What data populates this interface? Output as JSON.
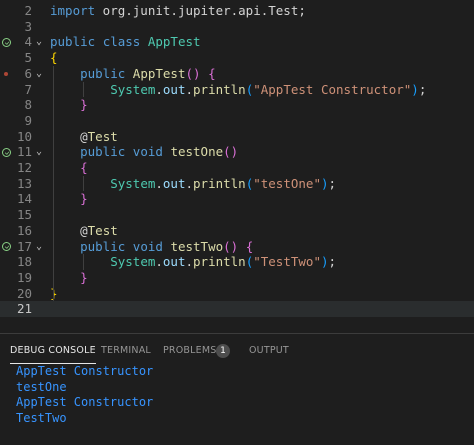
{
  "editor": {
    "lines": [
      {
        "no": "2",
        "icon": "",
        "fold": "",
        "current": false,
        "tokens": [
          [
            "kw",
            "import"
          ],
          [
            "pl",
            " org.junit.jupiter.api.Test;"
          ]
        ]
      },
      {
        "no": "3",
        "icon": "",
        "fold": "",
        "current": false,
        "tokens": []
      },
      {
        "no": "4",
        "icon": "run",
        "fold": "⌄",
        "current": false,
        "tokens": [
          [
            "kw",
            "public"
          ],
          [
            "pl",
            " "
          ],
          [
            "kw",
            "class"
          ],
          [
            "pl",
            " "
          ],
          [
            "cls",
            "AppTest"
          ]
        ]
      },
      {
        "no": "5",
        "icon": "",
        "fold": "",
        "current": false,
        "tokens": [
          [
            "br1",
            "{"
          ]
        ]
      },
      {
        "no": "6",
        "icon": "bp",
        "fold": "⌄",
        "current": false,
        "tokens": [
          [
            "pl",
            "    "
          ],
          [
            "kw",
            "public"
          ],
          [
            "pl",
            " "
          ],
          [
            "fn",
            "AppTest"
          ],
          [
            "br2",
            "()"
          ],
          [
            "pl",
            " "
          ],
          [
            "br2",
            "{"
          ]
        ]
      },
      {
        "no": "7",
        "icon": "",
        "fold": "",
        "current": false,
        "tokens": [
          [
            "pl",
            "        "
          ],
          [
            "cls",
            "System"
          ],
          [
            "pl",
            "."
          ],
          [
            "id",
            "out"
          ],
          [
            "pl",
            "."
          ],
          [
            "fn",
            "println"
          ],
          [
            "br3",
            "("
          ],
          [
            "str",
            "\"AppTest Constructor\""
          ],
          [
            "br3",
            ")"
          ],
          [
            "pl",
            ";"
          ]
        ]
      },
      {
        "no": "8",
        "icon": "",
        "fold": "",
        "current": false,
        "tokens": [
          [
            "pl",
            "    "
          ],
          [
            "br2",
            "}"
          ]
        ]
      },
      {
        "no": "9",
        "icon": "",
        "fold": "",
        "current": false,
        "tokens": []
      },
      {
        "no": "10",
        "icon": "",
        "fold": "",
        "current": false,
        "tokens": [
          [
            "pl",
            "    "
          ],
          [
            "ann-at",
            "@"
          ],
          [
            "ann",
            "Test"
          ]
        ]
      },
      {
        "no": "11",
        "icon": "run",
        "fold": "⌄",
        "current": false,
        "tokens": [
          [
            "pl",
            "    "
          ],
          [
            "kw",
            "public"
          ],
          [
            "pl",
            " "
          ],
          [
            "kw",
            "void"
          ],
          [
            "pl",
            " "
          ],
          [
            "fn",
            "testOne"
          ],
          [
            "br2",
            "()"
          ]
        ]
      },
      {
        "no": "12",
        "icon": "",
        "fold": "",
        "current": false,
        "tokens": [
          [
            "pl",
            "    "
          ],
          [
            "br2",
            "{"
          ]
        ]
      },
      {
        "no": "13",
        "icon": "",
        "fold": "",
        "current": false,
        "tokens": [
          [
            "pl",
            "        "
          ],
          [
            "cls",
            "System"
          ],
          [
            "pl",
            "."
          ],
          [
            "id",
            "out"
          ],
          [
            "pl",
            "."
          ],
          [
            "fn",
            "println"
          ],
          [
            "br3",
            "("
          ],
          [
            "str",
            "\"testOne\""
          ],
          [
            "br3",
            ")"
          ],
          [
            "pl",
            ";"
          ]
        ]
      },
      {
        "no": "14",
        "icon": "",
        "fold": "",
        "current": false,
        "tokens": [
          [
            "pl",
            "    "
          ],
          [
            "br2",
            "}"
          ]
        ]
      },
      {
        "no": "15",
        "icon": "",
        "fold": "",
        "current": false,
        "tokens": []
      },
      {
        "no": "16",
        "icon": "",
        "fold": "",
        "current": false,
        "tokens": [
          [
            "pl",
            "    "
          ],
          [
            "ann-at",
            "@"
          ],
          [
            "ann",
            "Test"
          ]
        ]
      },
      {
        "no": "17",
        "icon": "run",
        "fold": "⌄",
        "current": false,
        "tokens": [
          [
            "pl",
            "    "
          ],
          [
            "kw",
            "public"
          ],
          [
            "pl",
            " "
          ],
          [
            "kw",
            "void"
          ],
          [
            "pl",
            " "
          ],
          [
            "fn",
            "testTwo"
          ],
          [
            "br2",
            "()"
          ],
          [
            "pl",
            " "
          ],
          [
            "br2",
            "{"
          ]
        ]
      },
      {
        "no": "18",
        "icon": "",
        "fold": "",
        "current": false,
        "tokens": [
          [
            "pl",
            "        "
          ],
          [
            "cls",
            "System"
          ],
          [
            "pl",
            "."
          ],
          [
            "id",
            "out"
          ],
          [
            "pl",
            "."
          ],
          [
            "fn",
            "println"
          ],
          [
            "br3",
            "("
          ],
          [
            "str",
            "\"TestTwo\""
          ],
          [
            "br3",
            ")"
          ],
          [
            "pl",
            ";"
          ]
        ]
      },
      {
        "no": "19",
        "icon": "",
        "fold": "",
        "current": false,
        "tokens": [
          [
            "pl",
            "    "
          ],
          [
            "br2",
            "}"
          ]
        ]
      },
      {
        "no": "20",
        "icon": "",
        "fold": "",
        "current": false,
        "tokens": [
          [
            "br1",
            "}"
          ]
        ]
      },
      {
        "no": "21",
        "icon": "",
        "fold": "",
        "current": true,
        "tokens": []
      }
    ]
  },
  "panel": {
    "tabs": [
      {
        "id": "debug-console",
        "label": "DEBUG CONSOLE",
        "active": true
      },
      {
        "id": "terminal",
        "label": "TERMINAL",
        "active": false
      },
      {
        "id": "problems",
        "label": "PROBLEMS",
        "active": false,
        "badge": "1"
      },
      {
        "id": "output",
        "label": "OUTPUT",
        "active": false
      }
    ],
    "console_lines": [
      "AppTest Constructor",
      "testOne",
      "AppTest Constructor",
      "TestTwo"
    ]
  },
  "colors": {
    "background": "#1e1e1e",
    "keyword": "#569cd6",
    "type": "#4ec9b0",
    "function": "#dcdcaa",
    "string": "#ce9178",
    "console_text": "#3794ff",
    "test_run_icon": "#89d185"
  }
}
